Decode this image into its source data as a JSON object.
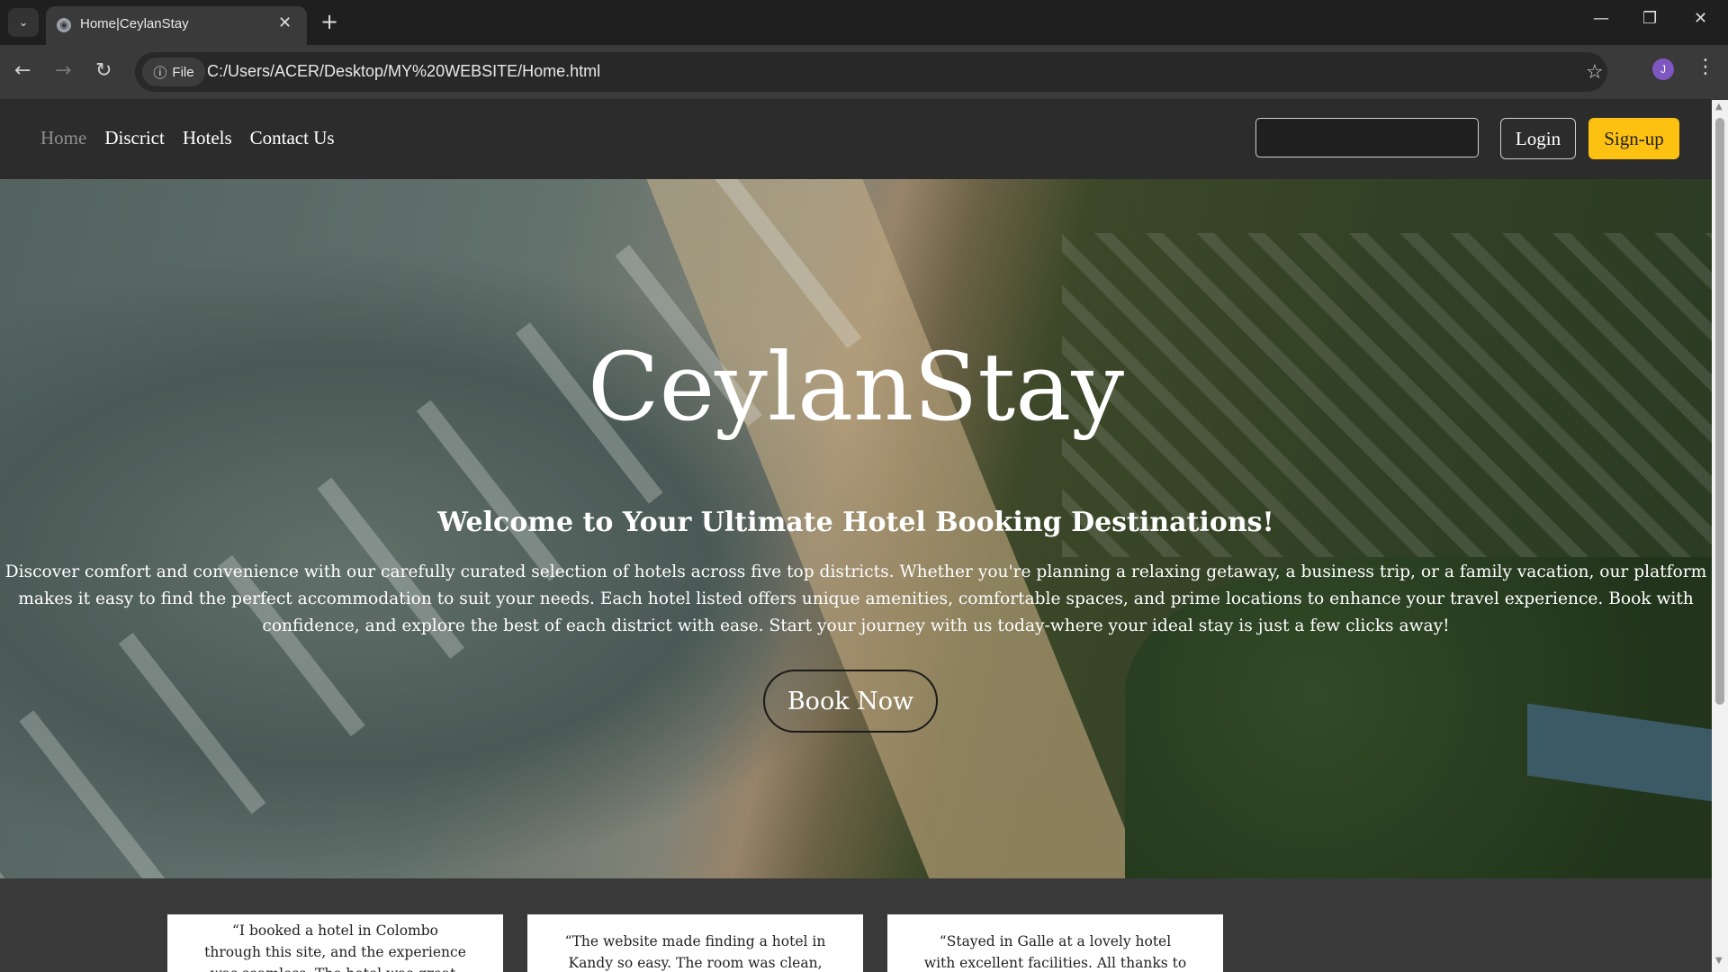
{
  "browser": {
    "tab_title": "Home|CeylanStay",
    "url_chip": "File",
    "url": "C:/Users/ACER/Desktop/MY%20WEBSITE/Home.html",
    "profile_initial": "J"
  },
  "site": {
    "nav": {
      "home": "Home",
      "district": "Discrict",
      "hotels": "Hotels",
      "contact": "Contact Us"
    },
    "search": {
      "value": "",
      "placeholder": ""
    },
    "login_label": "Login",
    "signup_label": "Sign-up",
    "accent_color": "#fdc112"
  },
  "hero": {
    "title": "CeylanStay",
    "subtitle": "Welcome to Your Ultimate Hotel Booking Destinations!",
    "text": "Discover comfort and convenience with our carefully curated selection of hotels across five top districts. Whether you're planning a relaxing getaway, a business trip, or a family vacation, our platform makes it easy to find the perfect accommodation to suit your needs. Each hotel listed offers unique amenities, comfortable spaces, and prime locations to enhance your travel experience. Book with confidence, and explore the best of each district with ease. Start your journey with us today-where your ideal stay is just a few clicks away!",
    "book_label": "Book Now"
  },
  "testimonials": [
    {
      "text": "“I booked a hotel in Colombo through this site, and the experience was seamless. The hotel was great, and the"
    },
    {
      "text": "“The website made finding a hotel in Kandy so easy. The room was clean,"
    },
    {
      "text": "“Stayed in Galle at a lovely hotel with excellent facilities. All thanks to this"
    }
  ]
}
